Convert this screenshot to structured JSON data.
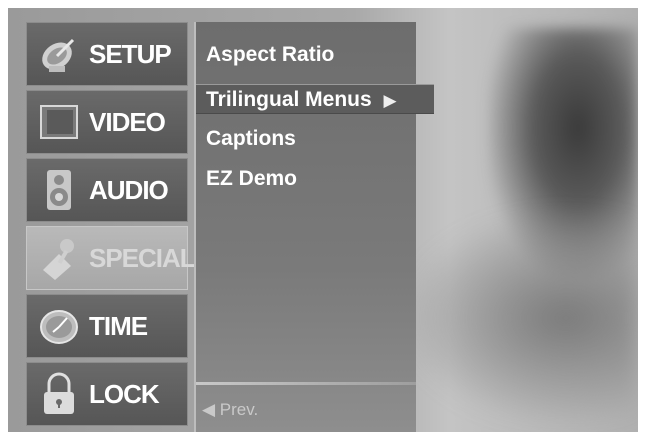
{
  "sidebar": {
    "items": [
      {
        "label": "SETUP",
        "icon": "satellite-dish-icon",
        "enabled": true
      },
      {
        "label": "VIDEO",
        "icon": "screen-icon",
        "enabled": true
      },
      {
        "label": "AUDIO",
        "icon": "speaker-icon",
        "enabled": true
      },
      {
        "label": "SPECIAL",
        "icon": "special-tools-icon",
        "enabled": false
      },
      {
        "label": "TIME",
        "icon": "clock-icon",
        "enabled": true
      },
      {
        "label": "LOCK",
        "icon": "padlock-icon",
        "enabled": true
      }
    ]
  },
  "submenu": {
    "items": [
      {
        "label": "Aspect Ratio"
      },
      {
        "label": "Trilingual Menus",
        "arrow": "▶",
        "selected": true
      },
      {
        "label": "Captions"
      },
      {
        "label": "EZ Demo"
      }
    ],
    "prev_label": "◀ Prev."
  }
}
